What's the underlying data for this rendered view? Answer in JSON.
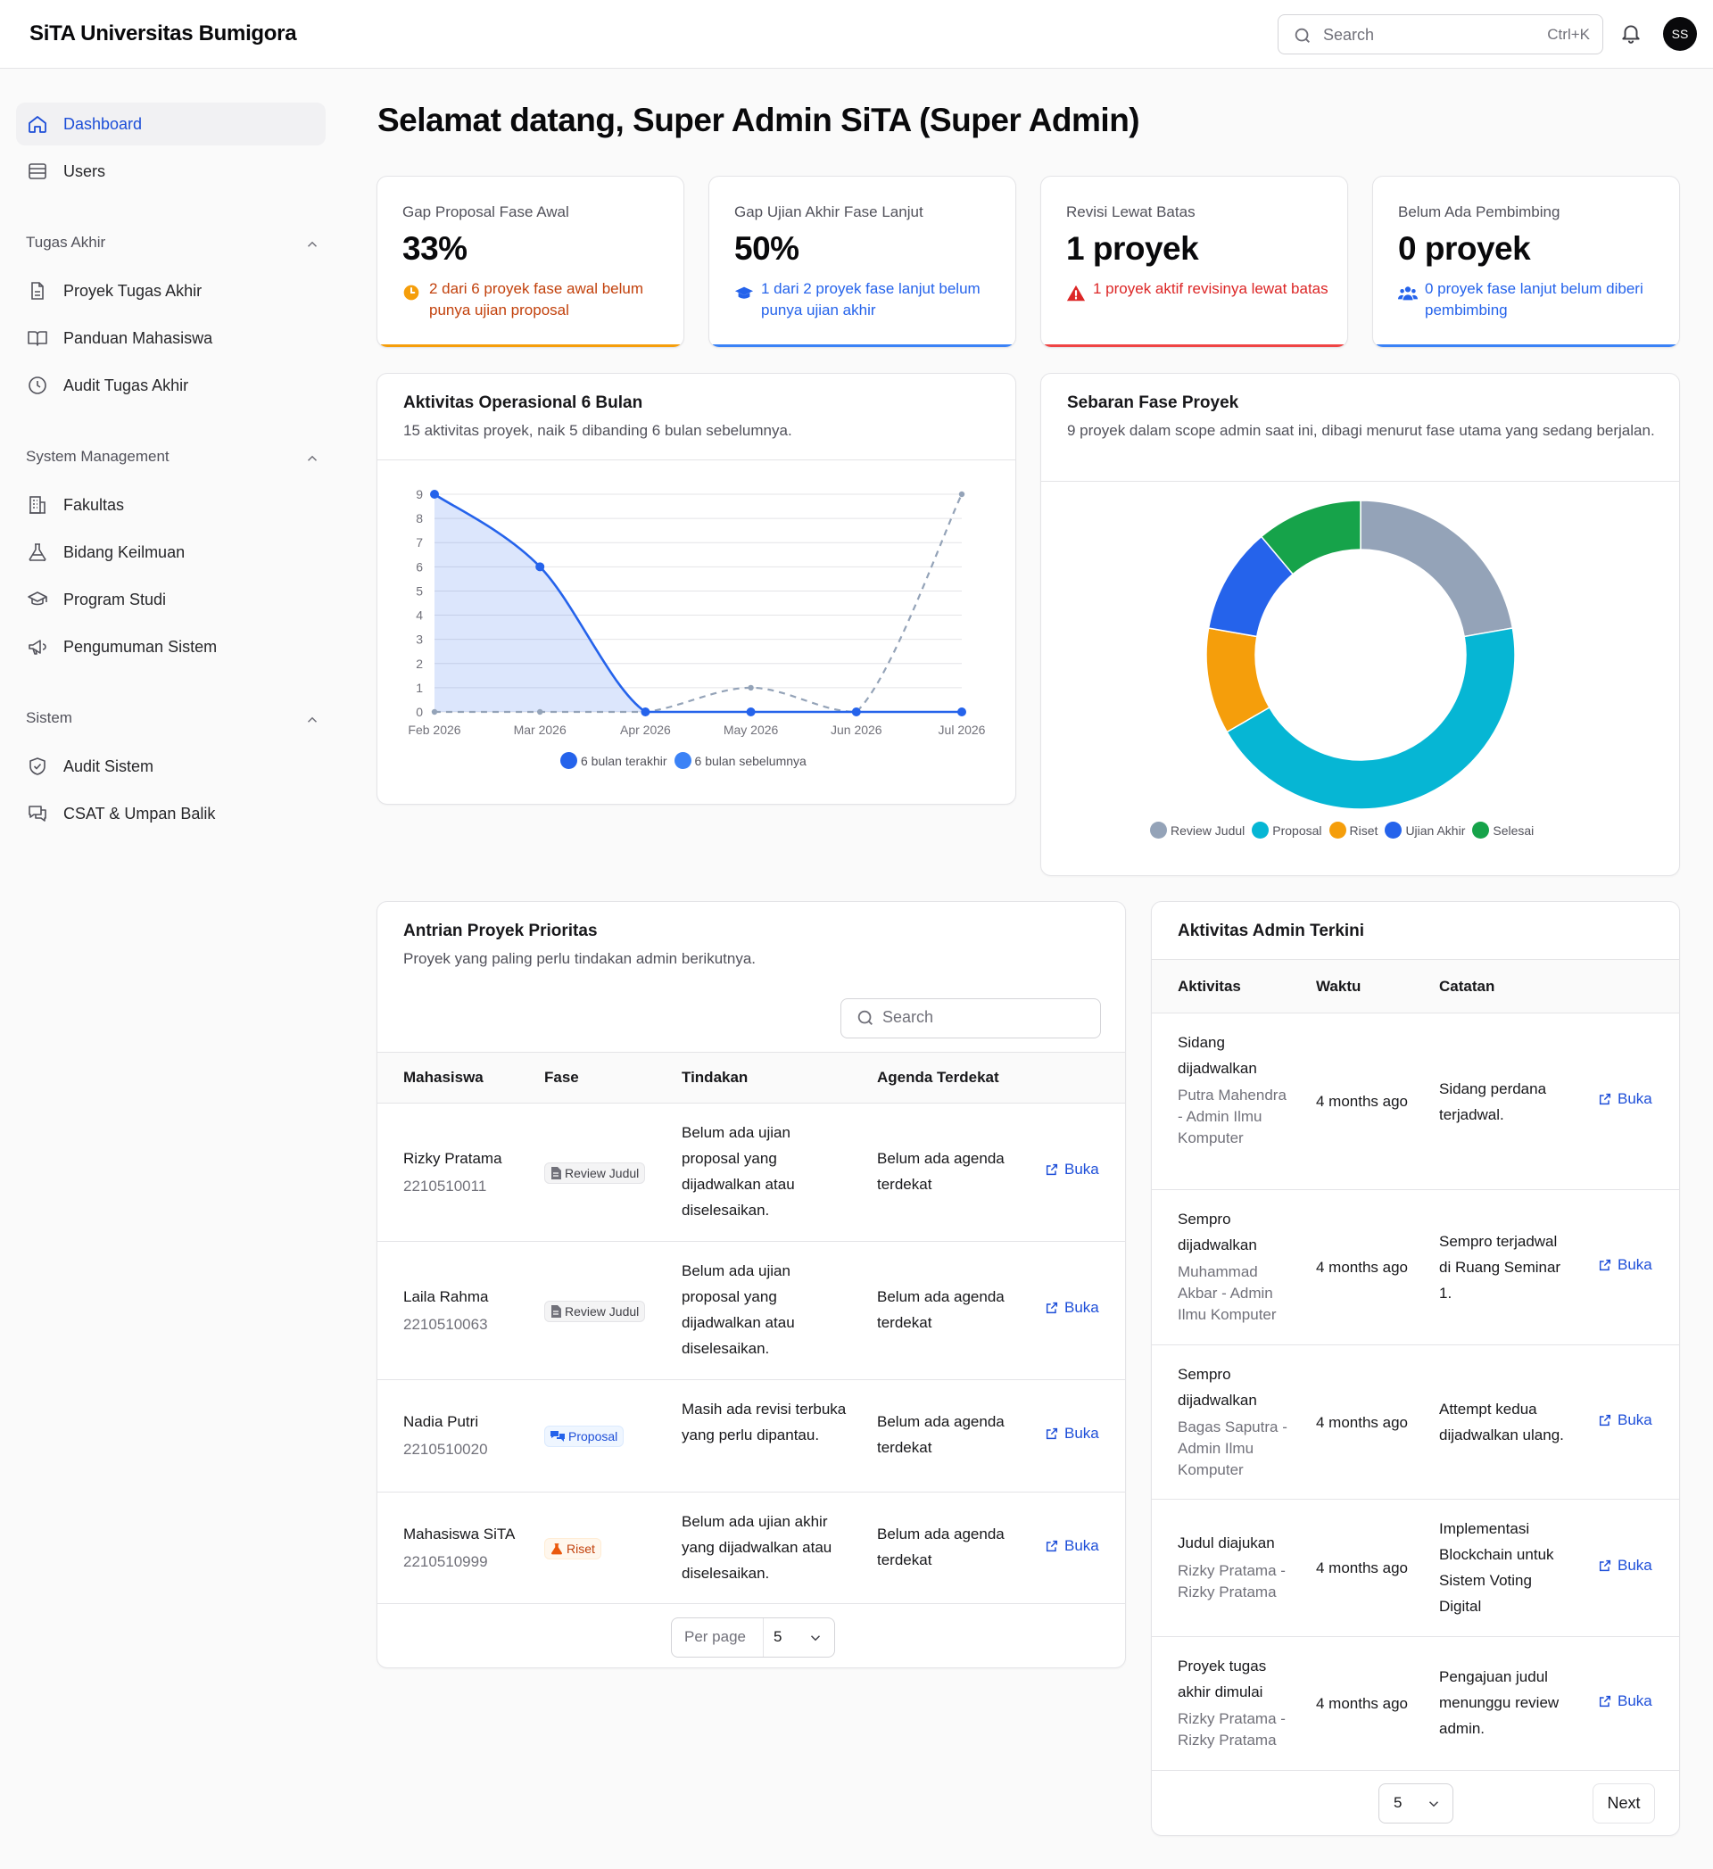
{
  "app": {
    "brand": "SiTA Universitas Bumigora"
  },
  "topbar": {
    "search_placeholder": "Search",
    "search_shortcut": "Ctrl+K",
    "avatar_initials": "SS"
  },
  "sidebar": {
    "items": [
      {
        "label": "Dashboard",
        "icon": "home-icon"
      },
      {
        "label": "Users",
        "icon": "users-icon"
      }
    ],
    "groups": [
      {
        "label": "Tugas Akhir",
        "items": [
          "Proyek Tugas Akhir",
          "Panduan Mahasiswa",
          "Audit Tugas Akhir"
        ]
      },
      {
        "label": "System Management",
        "items": [
          "Fakultas",
          "Bidang Keilmuan",
          "Program Studi",
          "Pengumuman Sistem"
        ]
      },
      {
        "label": "Sistem",
        "items": [
          "Audit Sistem",
          "CSAT & Umpan Balik"
        ]
      }
    ]
  },
  "page": {
    "title": "Selamat datang, Super Admin SiTA (Super Admin)"
  },
  "kpis": [
    {
      "title": "Gap Proposal Fase Awal",
      "value": "33%",
      "note": "2 dari 6 proyek fase awal belum punya ujian proposal",
      "color": "#c2410c",
      "bar": "#f59e0b",
      "icon": "clock-icon"
    },
    {
      "title": "Gap Ujian Akhir Fase Lanjut",
      "value": "50%",
      "note": "1 dari 2 proyek fase lanjut belum punya ujian akhir",
      "color": "#2563eb",
      "bar": "#3b82f6",
      "icon": "graduation-cap-icon"
    },
    {
      "title": "Revisi Lewat Batas",
      "value": "1 proyek",
      "note": "1 proyek aktif revisinya lewat batas",
      "color": "#dc2626",
      "bar": "#ef4444",
      "icon": "alert-triangle-icon"
    },
    {
      "title": "Belum Ada Pembimbing",
      "value": "0 proyek",
      "note": "0 proyek fase lanjut belum diberi pembimbing",
      "color": "#2563eb",
      "bar": "#3b82f6",
      "icon": "users-icon"
    }
  ],
  "activity_chart": {
    "title": "Aktivitas Operasional 6 Bulan",
    "subtitle": "15 aktivitas proyek, naik 5 dibanding 6 bulan sebelumnya."
  },
  "phase_chart": {
    "title": "Sebaran Fase Proyek",
    "subtitle": "9 proyek dalam scope admin saat ini, dibagi menurut fase utama yang sedang berjalan."
  },
  "chart_data": [
    {
      "type": "line",
      "x": [
        "Feb 2026",
        "Mar 2026",
        "Apr 2026",
        "May 2026",
        "Jun 2026",
        "Jul 2026"
      ],
      "ylim": [
        0,
        9
      ],
      "yticks": [
        0,
        1,
        2,
        3,
        4,
        5,
        6,
        7,
        8,
        9
      ],
      "grid": true,
      "legend": "bottom",
      "series": [
        {
          "name": "6 bulan terakhir",
          "values": [
            9,
            6,
            0,
            0,
            0,
            0
          ],
          "color": "#2563eb",
          "style": "solid-area"
        },
        {
          "name": "6 bulan sebelumnya",
          "values": [
            0,
            0,
            0,
            1,
            0,
            9
          ],
          "color": "#94a3b8",
          "style": "dashed"
        }
      ]
    },
    {
      "type": "pie",
      "donut": true,
      "legend": "bottom",
      "categories": [
        "Review Judul",
        "Proposal",
        "Riset",
        "Ujian Akhir",
        "Selesai"
      ],
      "values": [
        2,
        4,
        1,
        1,
        1
      ],
      "colors": [
        "#94a3b8",
        "#06b6d4",
        "#f59e0b",
        "#2563eb",
        "#16a34a"
      ]
    }
  ],
  "queue": {
    "title": "Antrian Proyek Prioritas",
    "subtitle": "Proyek yang paling perlu tindakan admin berikutnya.",
    "search_placeholder": "Search",
    "columns": [
      "Mahasiswa",
      "Fase",
      "Tindakan",
      "Agenda Terdekat"
    ],
    "link_label": "Buka",
    "rows": [
      {
        "name": "Rizky Pratama",
        "nim": "2210510011",
        "phase": "Review Judul",
        "phase_style": "gray",
        "action": "Belum ada ujian proposal yang dijadwalkan atau diselesaikan.",
        "agenda": "Belum ada agenda terdekat"
      },
      {
        "name": "Laila Rahma",
        "nim": "2210510063",
        "phase": "Review Judul",
        "phase_style": "gray",
        "action": "Belum ada ujian proposal yang dijadwalkan atau diselesaikan.",
        "agenda": "Belum ada agenda terdekat"
      },
      {
        "name": "Nadia Putri",
        "nim": "2210510020",
        "phase": "Proposal",
        "phase_style": "blue",
        "action": "Masih ada revisi terbuka yang perlu dipantau.",
        "agenda": "Belum ada agenda terdekat"
      },
      {
        "name": "Mahasiswa SiTA",
        "nim": "2210510999",
        "phase": "Riset",
        "phase_style": "orange",
        "action": "Belum ada ujian akhir yang dijadwalkan atau diselesaikan.",
        "agenda": "Belum ada agenda terdekat"
      }
    ],
    "per_page_label": "Per page",
    "per_page_value": "5"
  },
  "admin_activity": {
    "title": "Aktivitas Admin Terkini",
    "columns": [
      "Aktivitas",
      "Waktu",
      "Catatan"
    ],
    "link_label": "Buka",
    "rows": [
      {
        "activity": "Sidang dijadwalkan",
        "actor": "Putra Mahendra - Admin Ilmu Komputer",
        "time": "4 months ago",
        "note": "Sidang perdana terjadwal."
      },
      {
        "activity": "Sempro dijadwalkan",
        "actor": "Muhammad Akbar - Admin Ilmu Komputer",
        "time": "4 months ago",
        "note": "Sempro terjadwal di Ruang Seminar 1."
      },
      {
        "activity": "Sempro dijadwalkan",
        "actor": "Bagas Saputra - Admin Ilmu Komputer",
        "time": "4 months ago",
        "note": "Attempt kedua dijadwalkan ulang."
      },
      {
        "activity": "Judul diajukan",
        "actor": "Rizky Pratama - Rizky Pratama",
        "time": "4 months ago",
        "note": "Implementasi Blockchain untuk Sistem Voting Digital"
      },
      {
        "activity": "Proyek tugas akhir dimulai",
        "actor": "Rizky Pratama - Rizky Pratama",
        "time": "4 months ago",
        "note": "Pengajuan judul menunggu review admin."
      }
    ],
    "per_page_value": "5",
    "next_label": "Next"
  }
}
